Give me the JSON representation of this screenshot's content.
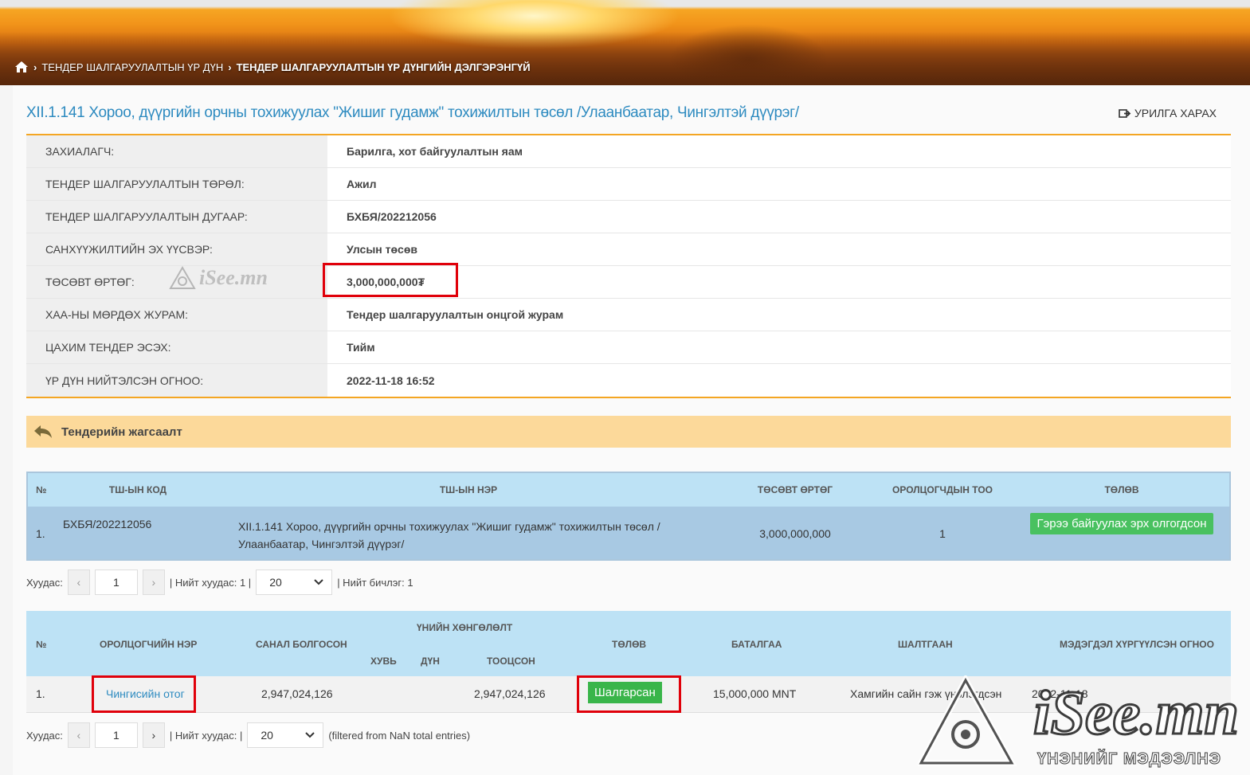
{
  "breadcrumb": {
    "item1": "ТЕНДЕР ШАЛГАРУУЛАЛТЫН ҮР ДҮН",
    "item2": "ТЕНДЕР ШАЛГАРУУЛАЛТЫН ҮР ДҮНГИЙН ДЭЛГЭРЭНГҮЙ"
  },
  "title": "XII.1.141 Хороо, дүүргийн орчны тохижуулах \"Жишиг гудамж\" тохижилтын төсөл /Улаанбаатар, Чингэлтэй дүүрэг/",
  "print_link": "УРИЛГА ХАРАХ",
  "info": [
    {
      "label": "ЗАХИАЛАГЧ:",
      "value": "Барилга, хот байгуулалтын яам"
    },
    {
      "label": "ТЕНДЕР ШАЛГАРУУЛАЛТЫН ТӨРӨЛ:",
      "value": "Ажил"
    },
    {
      "label": "ТЕНДЕР ШАЛГАРУУЛАЛТЫН ДУГААР:",
      "value": "БХБЯ/202212056"
    },
    {
      "label": "САНХҮҮЖИЛТИЙН ЭХ ҮҮСВЭР:",
      "value": "Улсын төсөв"
    },
    {
      "label": "ТӨСӨВТ ӨРТӨГ:",
      "value": "3,000,000,000₮"
    },
    {
      "label": "ХАА-НЫ МӨРДӨХ ЖУРАМ:",
      "value": "Тендер шалгаруулалтын онцгой журам"
    },
    {
      "label": "ЦАХИМ ТЕНДЕР ЭСЭХ:",
      "value": "Тийм"
    },
    {
      "label": "ҮР ДҮН НИЙТЭЛСЭН ОГНОО:",
      "value": "2022-11-18 16:52"
    }
  ],
  "section_title": "Тендерийн жагсаалт",
  "tender_table": {
    "headers": [
      "№",
      "ТШ-ЫН КОД",
      "ТШ-ЫН НЭР",
      "ТӨСӨВТ ӨРТӨГ",
      "ОРОЛЦОГЧДЫН ТОО",
      "ТӨЛӨВ"
    ],
    "row": {
      "no": "1.",
      "code": "БХБЯ/202212056",
      "name": "XII.1.141 Хороо, дүүргийн орчны тохижуулах \"Жишиг гудамж\" тохижилтын төсөл /Улаанбаатар, Чингэлтэй дүүрэг/",
      "budget": "3,000,000,000",
      "participants": "1",
      "status": "Гэрээ байгуулах эрх олгогдсон"
    }
  },
  "pager1": {
    "label": "Хуудас:",
    "prev": "‹",
    "page": "1",
    "next": "›",
    "total_pages": "| Нийт хуудас: 1 |",
    "page_size": "20",
    "total_records": "| Нийт бичлэг: 1"
  },
  "participants_table": {
    "headers": {
      "no": "№",
      "name": "ОРОЛЦОГЧИЙН НЭР",
      "offer": "САНАЛ БОЛГОСОН",
      "discount": "ҮНИЙН ХӨНГӨЛӨЛТ",
      "percent": "ХУВЬ",
      "amount": "ДҮН",
      "calculated": "ТООЦСОН",
      "status": "ТӨЛӨВ",
      "guarantee": "БАТАЛГАА",
      "reason": "ШАЛТГААН",
      "notify_date": "МЭДЭГДЭЛ ХҮРГҮҮЛСЭН ОГНОО"
    },
    "row": {
      "no": "1.",
      "name": "Чингисийн отог",
      "offer": "2,947,024,126",
      "calculated": "2,947,024,126",
      "status": "Шалгарсан",
      "guarantee": "15,000,000 MNT",
      "reason": "Хамгийн сайн гэж үнэлэгдсэн",
      "notify_date": "2022-11-18"
    }
  },
  "pager2": {
    "label": "Хуудас:",
    "prev": "‹",
    "page": "1",
    "next": "›",
    "total_pages": "| Нийт хуудас: |",
    "page_size": "20",
    "filtered": "(filtered from NaN total entries)"
  },
  "watermark": {
    "brand": "iSee.mn",
    "slogan": "ҮНЭНИЙГ МЭДЭЭЛНЭ"
  },
  "colors": {
    "accent_orange": "#f4a623",
    "link_blue": "#2e8bc0",
    "status_green": "#39b54a",
    "highlight_red": "#e0000a"
  }
}
